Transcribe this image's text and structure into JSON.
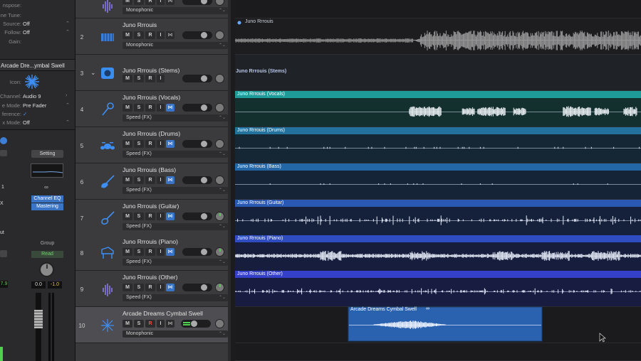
{
  "inspector": {
    "rows_top": [
      {
        "label": "nspose:",
        "value": ""
      },
      {
        "label": "ne Tune:",
        "value": ""
      },
      {
        "label": "Source:",
        "value": "Off"
      },
      {
        "label": "Follow:",
        "value": "Off"
      },
      {
        "label": "Gain:",
        "value": ""
      }
    ],
    "region_title": "Arcade Dre...ymbal Swell",
    "icon_label": "Icon:",
    "rows_mid": [
      {
        "label": "Channel:",
        "value": "Audio 9"
      },
      {
        "label": "e Mode:",
        "value": "Pre Fader"
      },
      {
        "label": "ference:",
        "value": "✓"
      },
      {
        "label": "x Mode:",
        "value": "Off"
      }
    ],
    "setting_label": "Setting",
    "plugins": [
      "Channel EQ",
      "Mastering"
    ],
    "group_label": "Group",
    "read_label": "Read",
    "left_values": [
      "1",
      "X",
      "ut"
    ],
    "val_a": "0.0",
    "val_b": "-1.0",
    "val_c": "7.9"
  },
  "tracks": [
    {
      "num": "",
      "name": "",
      "mode": "Monophonic",
      "icon": "waveform-icon"
    },
    {
      "num": "2",
      "name": "Juno Rrrouis",
      "mode": "Monophonic",
      "icon": "keyboard-icon"
    },
    {
      "num": "3",
      "name": "Juno Rrrouis (Stems)",
      "mode": "",
      "icon": "stems-folder-icon"
    },
    {
      "num": "4",
      "name": "Juno Rrrouis (Vocals)",
      "mode": "Speed (FX)",
      "icon": "microphone-icon"
    },
    {
      "num": "5",
      "name": "Juno Rrrouis (Drums)",
      "mode": "Speed (FX)",
      "icon": "drums-icon"
    },
    {
      "num": "6",
      "name": "Juno Rrrouis (Bass)",
      "mode": "Speed (FX)",
      "icon": "bass-guitar-icon"
    },
    {
      "num": "7",
      "name": "Juno Rrrouis (Guitar)",
      "mode": "Speed (FX)",
      "icon": "guitar-icon"
    },
    {
      "num": "8",
      "name": "Juno Rrrouis (Piano)",
      "mode": "Speed (FX)",
      "icon": "piano-icon"
    },
    {
      "num": "9",
      "name": "Juno Rrrouis (Other)",
      "mode": "Speed (FX)",
      "icon": "waveform-icon"
    },
    {
      "num": "10",
      "name": "Arcade Dreams Cymbal Swell",
      "mode": "Monophonic",
      "icon": "cymbal-icon"
    }
  ],
  "buttons": {
    "m": "M",
    "s": "S",
    "r": "R",
    "i": "I"
  },
  "regions": {
    "top": "Juno Rrrouis",
    "stems": "Juno Rrrouis (Stems)",
    "vocals": "Juno Rrrouis (Vocals)",
    "drums": "Juno Rrrouis (Drums)",
    "bass": "Juno Rrrouis (Bass)",
    "guitar": "Juno Rrrouis (Guitar)",
    "piano": "Juno Rrrouis (Piano)",
    "other": "Juno Rrrouis (Other)",
    "cymbal": "Arcade Dreams Cymbal Swell"
  },
  "colors": {
    "vocals": "#1e9a99",
    "drums": "#23729d",
    "bass": "#2367a6",
    "guitar": "#2a59b3",
    "piano": "#2f4cc0",
    "other": "#3540c8",
    "cymbal": "#2a62b0",
    "accent": "#3a74c4"
  }
}
